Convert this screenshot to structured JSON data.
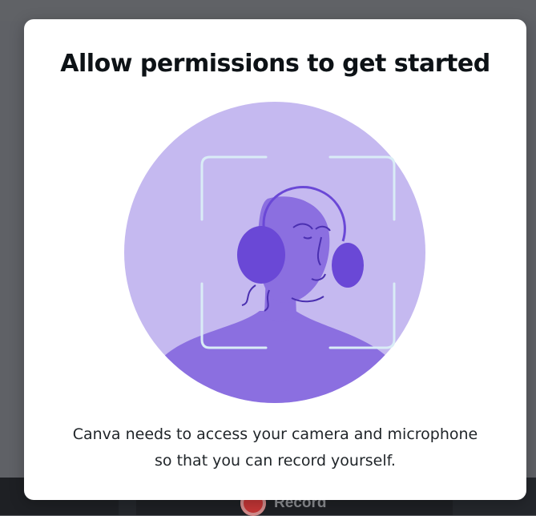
{
  "modal": {
    "title": "Allow permissions to get started",
    "description_line1": "Canva needs to access your camera and microphone",
    "description_line2": "so that you can record yourself."
  },
  "bottom_bar": {
    "record_label": "Record"
  },
  "icons": {
    "illustration": "person-with-headphones-in-camera-frame",
    "record": "record-dot-icon"
  },
  "colors": {
    "circle": "#c5b9f0",
    "figure": "#8b6fe0",
    "earcup": "#6a48d6",
    "frame": "#d9ecf6",
    "record": "#e23a3a"
  }
}
